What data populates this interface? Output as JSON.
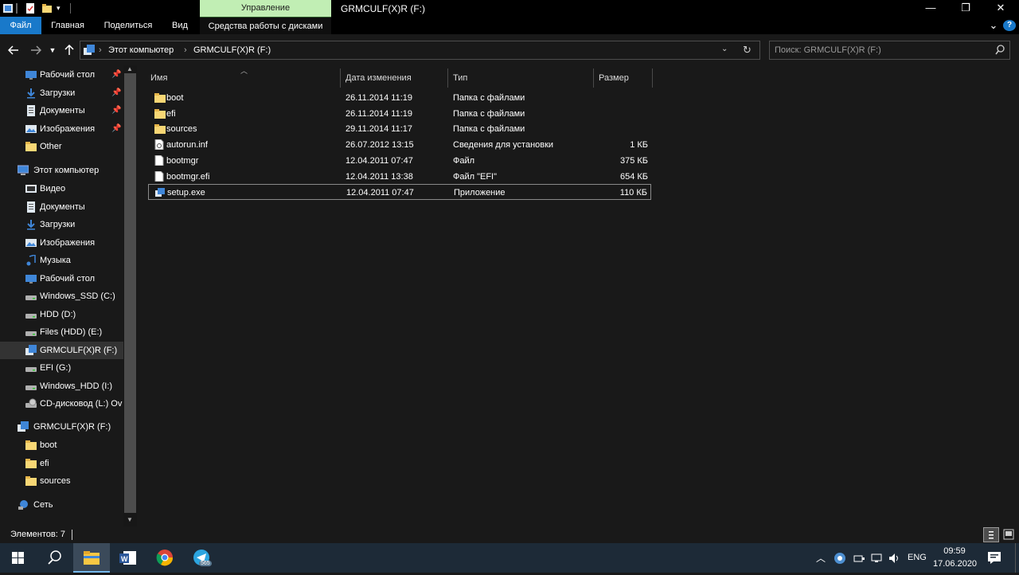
{
  "window": {
    "title": "GRMCULF(X)R (F:)",
    "manage_tab": "Управление",
    "minimize": "—",
    "maximize": "❐",
    "close": "✕"
  },
  "ribbon": {
    "file": "Файл",
    "home": "Главная",
    "share": "Поделиться",
    "view": "Вид",
    "drive_tools": "Средства работы с дисками",
    "expand": "⌄",
    "help": "?"
  },
  "address": {
    "separator": "›",
    "crumb_computer": "Этот компьютер",
    "crumb_drive": "GRMCULF(X)R (F:)",
    "search_placeholder": "Поиск: GRMCULF(X)R (F:)"
  },
  "sidebar": {
    "quick": [
      {
        "label": "Рабочий стол",
        "icon": "desktop-icon",
        "pinned": true
      },
      {
        "label": "Загрузки",
        "icon": "download-icon",
        "pinned": true
      },
      {
        "label": "Документы",
        "icon": "document-icon",
        "pinned": true
      },
      {
        "label": "Изображения",
        "icon": "pictures-icon",
        "pinned": true
      },
      {
        "label": "Other",
        "icon": "folder-icon",
        "pinned": false
      }
    ],
    "this_pc": "Этот компьютер",
    "pc_items": [
      {
        "label": "Видео",
        "icon": "video-icon"
      },
      {
        "label": "Документы",
        "icon": "document-icon"
      },
      {
        "label": "Загрузки",
        "icon": "download-icon"
      },
      {
        "label": "Изображения",
        "icon": "pictures-icon"
      },
      {
        "label": "Музыка",
        "icon": "music-icon"
      },
      {
        "label": "Рабочий стол",
        "icon": "desktop-icon"
      },
      {
        "label": "Windows_SSD (C:)",
        "icon": "drive-icon"
      },
      {
        "label": "HDD (D:)",
        "icon": "drive-icon"
      },
      {
        "label": "Files (HDD) (E:)",
        "icon": "drive-icon"
      },
      {
        "label": "GRMCULF(X)R (F:)",
        "icon": "setup-drive-icon",
        "selected": true
      },
      {
        "label": "EFI (G:)",
        "icon": "drive-icon"
      },
      {
        "label": "Windows_HDD (I:)",
        "icon": "drive-icon"
      },
      {
        "label": "CD-дисковод (L:) Ov",
        "icon": "cd-drive-icon"
      }
    ],
    "drive_root": "GRMCULF(X)R (F:)",
    "drive_children": [
      {
        "label": "boot"
      },
      {
        "label": "efi"
      },
      {
        "label": "sources"
      }
    ],
    "network": "Сеть"
  },
  "columns": {
    "name": "Имя",
    "date": "Дата изменения",
    "type": "Тип",
    "size": "Размер"
  },
  "files": [
    {
      "name": "boot",
      "date": "26.11.2014 11:19",
      "type": "Папка с файлами",
      "size": "",
      "icon": "folder-icon"
    },
    {
      "name": "efi",
      "date": "26.11.2014 11:19",
      "type": "Папка с файлами",
      "size": "",
      "icon": "folder-icon"
    },
    {
      "name": "sources",
      "date": "29.11.2014 11:17",
      "type": "Папка с файлами",
      "size": "",
      "icon": "folder-icon"
    },
    {
      "name": "autorun.inf",
      "date": "26.07.2012 13:15",
      "type": "Сведения для установки",
      "size": "1 КБ",
      "icon": "settings-file-icon"
    },
    {
      "name": "bootmgr",
      "date": "12.04.2011 07:47",
      "type": "Файл",
      "size": "375 КБ",
      "icon": "file-icon"
    },
    {
      "name": "bootmgr.efi",
      "date": "12.04.2011 13:38",
      "type": "Файл \"EFI\"",
      "size": "654 КБ",
      "icon": "file-icon"
    },
    {
      "name": "setup.exe",
      "date": "12.04.2011 07:47",
      "type": "Приложение",
      "size": "110 КБ",
      "icon": "setup-icon",
      "focused": true
    }
  ],
  "status": {
    "count": "Элементов: 7"
  },
  "taskbar": {
    "telegram_badge": "565",
    "lang": "ENG",
    "time": "09:59",
    "date": "17.06.2020"
  },
  "colors": {
    "accent": "#1979ca",
    "manage_tab": "#c1eeb4",
    "background": "#191919",
    "taskbar": "#1d2a37"
  }
}
